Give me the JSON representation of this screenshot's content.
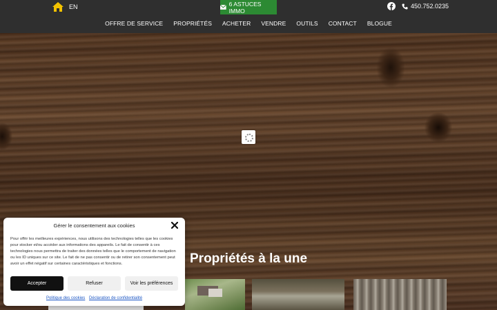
{
  "header": {
    "lang_label": "EN",
    "astuces_label": "6 ASTUCES IMMO",
    "phone": "450.752.0235",
    "nav": [
      "OFFRE DE SERVICE",
      "PROPRIÉTÉS",
      "ACHETER",
      "VENDRE",
      "OUTILS",
      "CONTACT",
      "BLOGUE"
    ]
  },
  "hero": {
    "section_title": "Propriétés à la une"
  },
  "consent": {
    "title": "Gérer le consentement aux cookies",
    "text": "Pour offrir les meilleures expériences, nous utilisons des technologies telles que les cookies pour stocker et/ou accéder aux informations des appareils. Le fait de consentir à ces technologies nous permettra de traiter des données telles que le comportement de navigation ou les ID uniques sur ce site. Le fait de ne pas consentir ou de retirer son consentement peut avoir un effet négatif sur certaines caractéristiques et fonctions.",
    "accept_label": "Accepter",
    "refuse_label": "Refuser",
    "prefs_label": "Voir les préférences",
    "policy_link": "Politique des cookies",
    "privacy_link": "Déclaration de confidentialité"
  },
  "colors": {
    "header_bg": "#2f2f2f",
    "accent_green": "#2c8a33",
    "home_icon": "#f2c200"
  },
  "icons": [
    "home-icon",
    "mail-icon",
    "facebook-icon",
    "phone-icon",
    "close-icon",
    "loading-spinner"
  ]
}
